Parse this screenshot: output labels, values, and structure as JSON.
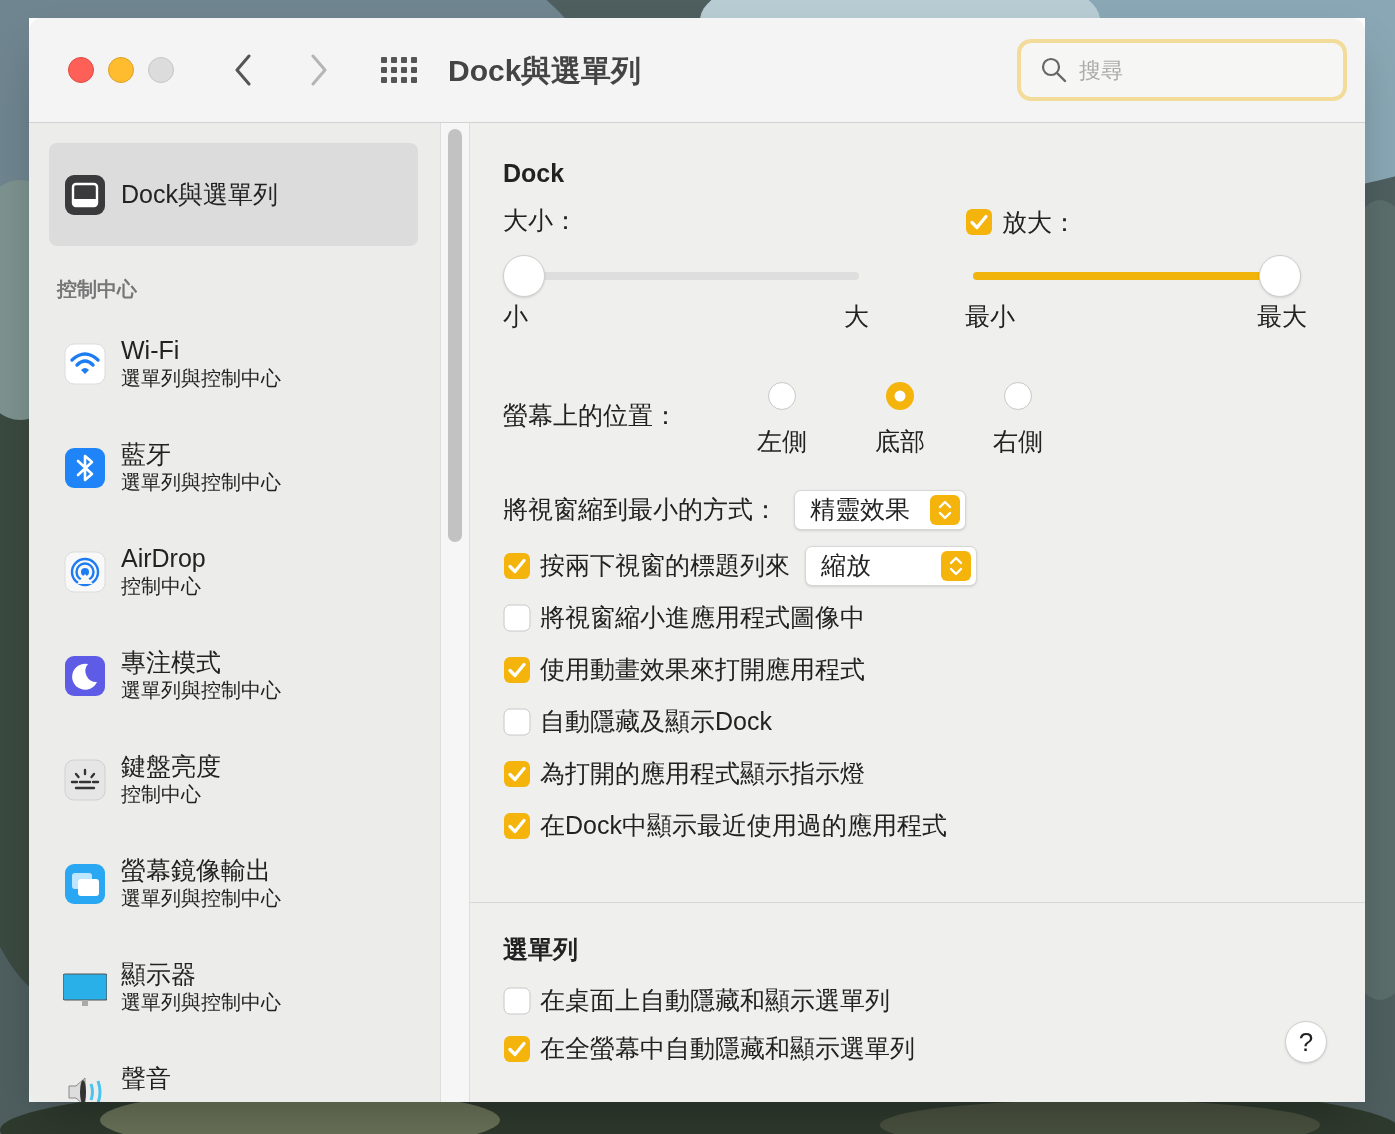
{
  "window": {
    "title": "Dock與選單列"
  },
  "search": {
    "placeholder": "搜尋"
  },
  "sidebar": {
    "items": [
      {
        "kind": "dock",
        "title": "Dock與選單列",
        "selected": true
      }
    ],
    "sections": [
      {
        "heading": "控制中心",
        "items": [
          {
            "kind": "wifi",
            "title": "Wi-Fi",
            "subtitle": "選單列與控制中心",
            "selected": false
          },
          {
            "kind": "bluetooth",
            "title": "藍牙",
            "subtitle": "選單列與控制中心",
            "selected": false
          },
          {
            "kind": "airdrop",
            "title": "AirDrop",
            "subtitle": "控制中心",
            "selected": false
          },
          {
            "kind": "focus",
            "title": "專注模式",
            "subtitle": "選單列與控制中心",
            "selected": false
          },
          {
            "kind": "keyboard",
            "title": "鍵盤亮度",
            "subtitle": "控制中心",
            "selected": false
          },
          {
            "kind": "mirroring",
            "title": "螢幕鏡像輸出",
            "subtitle": "選單列與控制中心",
            "selected": false
          },
          {
            "kind": "display",
            "title": "顯示器",
            "subtitle": "選單列與控制中心",
            "selected": false
          },
          {
            "kind": "sound",
            "title": "聲音",
            "selected": false
          }
        ]
      }
    ]
  },
  "dock": {
    "heading": "Dock",
    "size": {
      "label": "大小：",
      "level": 0,
      "min_label": "小",
      "max_label": "大"
    },
    "magnification": {
      "label": "放大：",
      "checked": true,
      "level": 1,
      "min_label": "最小",
      "max_label": "最大"
    },
    "position": {
      "label": "螢幕上的位置：",
      "options": [
        {
          "label": "左側",
          "selected": false
        },
        {
          "label": "底部",
          "selected": true
        },
        {
          "label": "右側",
          "selected": false
        }
      ]
    },
    "minimize": {
      "label": "將視窗縮到最小的方式：",
      "value": "精靈效果"
    },
    "options": [
      {
        "kind": "select",
        "label": "按兩下視窗的標題列來",
        "checked": true,
        "value": "縮放"
      },
      {
        "kind": "checkbox",
        "label": "將視窗縮小進應用程式圖像中",
        "checked": false
      },
      {
        "kind": "checkbox",
        "label": "使用動畫效果來打開應用程式",
        "checked": true
      },
      {
        "kind": "checkbox",
        "label": "自動隱藏及顯示Dock",
        "checked": false
      },
      {
        "kind": "checkbox",
        "label": "為打開的應用程式顯示指示燈",
        "checked": true
      },
      {
        "kind": "checkbox",
        "label": "在Dock中顯示最近使用過的應用程式",
        "checked": true
      }
    ]
  },
  "menu_bar": {
    "heading": "選單列",
    "options": [
      {
        "kind": "checkbox",
        "label": "在桌面上自動隱藏和顯示選單列",
        "checked": false
      },
      {
        "kind": "checkbox",
        "label": "在全螢幕中自動隱藏和顯示選單列",
        "checked": true
      }
    ]
  },
  "help": {
    "label": "?"
  }
}
